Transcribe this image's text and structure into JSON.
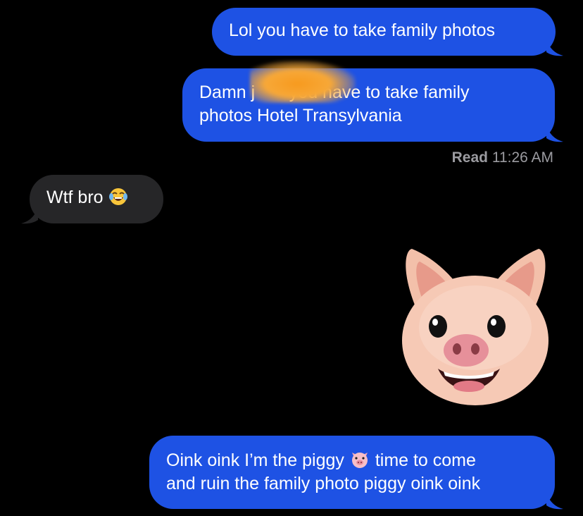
{
  "conversation": {
    "messages": [
      {
        "text": "Lol you have to take family photos"
      },
      {
        "line1": "Damn j       you have to take family",
        "line2": "photos Hotel Transylvania"
      },
      {
        "text": "Wtf bro",
        "emoji": "face-with-tears-of-joy"
      },
      {
        "line1_a": "Oink oink I’m the piggy",
        "line1_b": "time to come",
        "line2": "and ruin the family photo piggy oink oink",
        "emoji": "pig-face"
      }
    ],
    "receipt": {
      "status": "Read",
      "time": "11:26 AM"
    },
    "animoji": "pig-animoji"
  },
  "colors": {
    "sent": "#1e52e4",
    "received": "#262628",
    "background": "#000000",
    "blur": "#f7a838"
  }
}
